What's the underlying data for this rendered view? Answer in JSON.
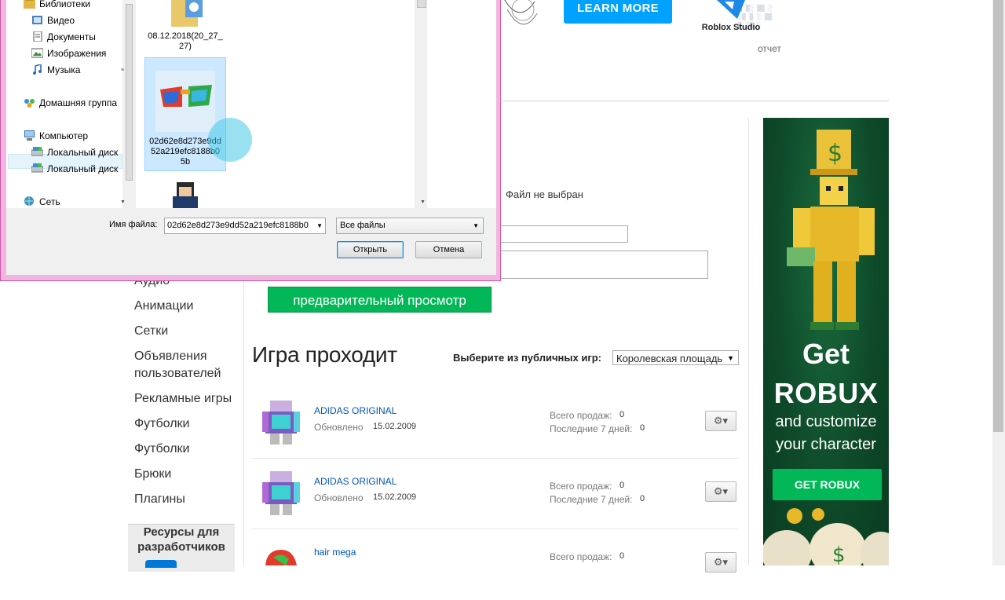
{
  "header": {
    "learn_more": "LEARN MORE",
    "studio_label": "Roblox Studio",
    "report": "отчет"
  },
  "upload": {
    "no_file": "Файл не выбран",
    "preview_button": "предварительный просмотр"
  },
  "left_nav": {
    "items": [
      "Аудио",
      "Анимации",
      "Сетки",
      "Объявления пользователей",
      "Рекламные игры",
      "Футболки",
      "Футболки",
      "Брюки",
      "Плагины"
    ],
    "dev_resources": "Ресурсы для разработчиков"
  },
  "games": {
    "title": "Игра проходит",
    "public_label": "Выберите из публичных игр:",
    "public_selected": "Королевская площадь"
  },
  "items": [
    {
      "name": "ADIDAS ORIGINAL",
      "updated_label": "Обновлено",
      "updated": "15.02.2009",
      "sales_label": "Всего продаж:",
      "sales": "0",
      "week_label": "Последние 7 дней:",
      "week": "0"
    },
    {
      "name": "ADIDAS ORIGINAL",
      "updated_label": "Обновлено",
      "updated": "15.02.2009",
      "sales_label": "Всего продаж:",
      "sales": "0",
      "week_label": "Последние 7 дней:",
      "week": "0"
    },
    {
      "name": "hair mega",
      "updated_label": "",
      "updated": "",
      "sales_label": "Всего продаж:",
      "sales": "0",
      "week_label": "",
      "week": ""
    }
  ],
  "ad": {
    "line1": "Get",
    "line2": "ROBUX",
    "line3": "and customize",
    "line4": "your character",
    "button": "GET ROBUX"
  },
  "dialog": {
    "tree": [
      {
        "label": "Библиотеки",
        "icon": "library-icon"
      },
      {
        "label": "Видео",
        "icon": "video-icon"
      },
      {
        "label": "Документы",
        "icon": "documents-icon"
      },
      {
        "label": "Изображения",
        "icon": "images-icon"
      },
      {
        "label": "Музыка",
        "icon": "music-icon"
      },
      {
        "label": "Домашняя группа",
        "icon": "homegroup-icon"
      },
      {
        "label": "Компьютер",
        "icon": "computer-icon"
      },
      {
        "label": "Локальный диск",
        "icon": "drive-icon"
      },
      {
        "label": "Локальный диск",
        "icon": "drive-icon"
      },
      {
        "label": "Сеть",
        "icon": "network-icon"
      }
    ],
    "files": [
      {
        "name": "08.12.2018(20_27_27)"
      },
      {
        "name": "02d62e8d273e9dd52a219efc8188b05b"
      },
      {
        "name": ""
      }
    ],
    "file_name_label": "Имя файла:",
    "file_name_value": "02d62e8d273e9dd52a219efc8188b0",
    "file_type": "Все файлы",
    "open": "Открыть",
    "cancel": "Отмена"
  },
  "colors": {
    "accent_blue": "#00a2ff",
    "green": "#02b757",
    "dialog_frame": "#f0b6df",
    "link": "#0055b3"
  }
}
